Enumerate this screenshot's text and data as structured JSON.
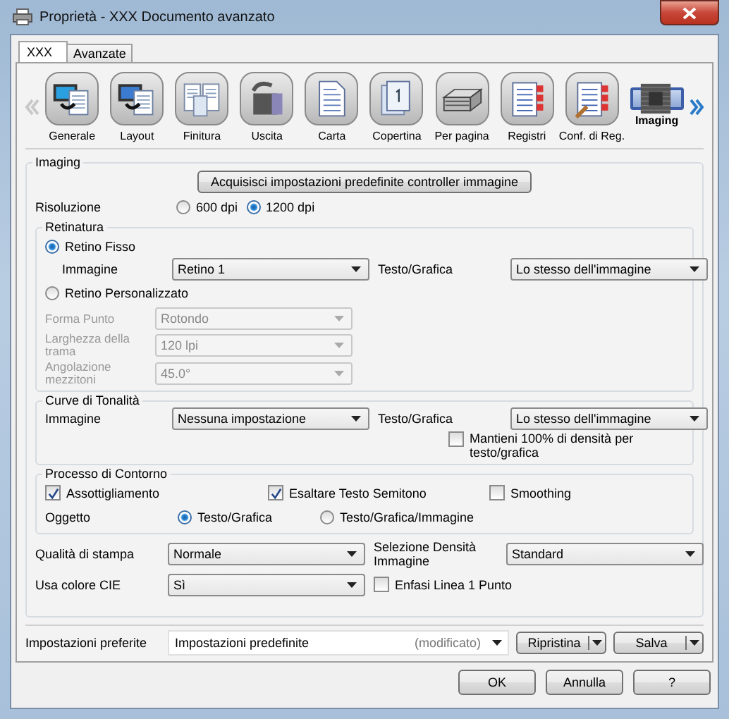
{
  "window": {
    "title": "Proprietà - XXX Documento avanzato"
  },
  "tabs": [
    {
      "label": "XXX",
      "selected": true
    },
    {
      "label": "Avanzate",
      "selected": false
    }
  ],
  "categories": [
    {
      "label": "Generale",
      "kind": "general",
      "selected": false
    },
    {
      "label": "Layout",
      "kind": "layout",
      "selected": false
    },
    {
      "label": "Finitura",
      "kind": "finishing",
      "selected": false
    },
    {
      "label": "Uscita",
      "kind": "output",
      "selected": false
    },
    {
      "label": "Carta",
      "kind": "paper",
      "selected": false
    },
    {
      "label": "Copertina",
      "kind": "cover",
      "selected": false
    },
    {
      "label": "Per pagina",
      "kind": "pages",
      "selected": false
    },
    {
      "label": "Registri",
      "kind": "tabs",
      "selected": false
    },
    {
      "label": "Conf. di Reg.",
      "kind": "tabsettings",
      "selected": false
    },
    {
      "label": "Imaging",
      "kind": "imaging",
      "selected": true
    }
  ],
  "imaging": {
    "title": "Imaging",
    "acquire_button": "Acquisisci impostazioni predefinite controller immagine",
    "resolution_label": "Risoluzione",
    "resolutions": [
      {
        "label": "600 dpi",
        "selected": false
      },
      {
        "label": "1200 dpi",
        "selected": true
      }
    ]
  },
  "screening": {
    "title": "Retinatura",
    "fixed": {
      "label": "Retino Fisso",
      "selected": true,
      "image_label": "Immagine",
      "image_value": "Retino 1",
      "text_label": "Testo/Grafica",
      "text_value": "Lo stesso dell'immagine"
    },
    "custom": {
      "label": "Retino Personalizzato",
      "selected": false,
      "rows": [
        {
          "label": "Forma Punto",
          "value": "Rotondo",
          "disabled": true
        },
        {
          "label": "Larghezza della trama",
          "value": "120 lpi",
          "disabled": true
        },
        {
          "label": "Angolazione mezzitoni",
          "value": "45.0°",
          "disabled": true
        }
      ]
    }
  },
  "tone_curves": {
    "title": "Curve di Tonalità",
    "image_label": "Immagine",
    "image_value": "Nessuna impostazione",
    "text_label": "Testo/Grafica",
    "text_value": "Lo stesso dell'immagine",
    "keep_density": {
      "label": "Mantieni 100% di densità per testo/grafica",
      "checked": false
    }
  },
  "contour": {
    "title": "Processo di Contorno",
    "options": [
      {
        "label": "Assottigliamento",
        "checked": true
      },
      {
        "label": "Esaltare Testo Semitono",
        "checked": true
      },
      {
        "label": "Smoothing",
        "checked": false
      }
    ],
    "object_label": "Oggetto",
    "objects": [
      {
        "label": "Testo/Grafica",
        "selected": true
      },
      {
        "label": "Testo/Grafica/Immagine",
        "selected": false
      }
    ]
  },
  "quality": {
    "label": "Qualità di stampa",
    "value": "Normale"
  },
  "density": {
    "label": "Selezione Densità Immagine",
    "value": "Standard"
  },
  "cie": {
    "label": "Usa colore CIE",
    "value": "Sì"
  },
  "line_emphasis": {
    "label": "Enfasi Linea 1 Punto",
    "checked": false
  },
  "favorites": {
    "label": "Impostazioni preferite",
    "value": "Impostazioni predefinite",
    "status": "(modificato)",
    "buttons": [
      "Ripristina",
      "Salva"
    ]
  },
  "buttons": [
    "OK",
    "Annulla",
    "?"
  ]
}
